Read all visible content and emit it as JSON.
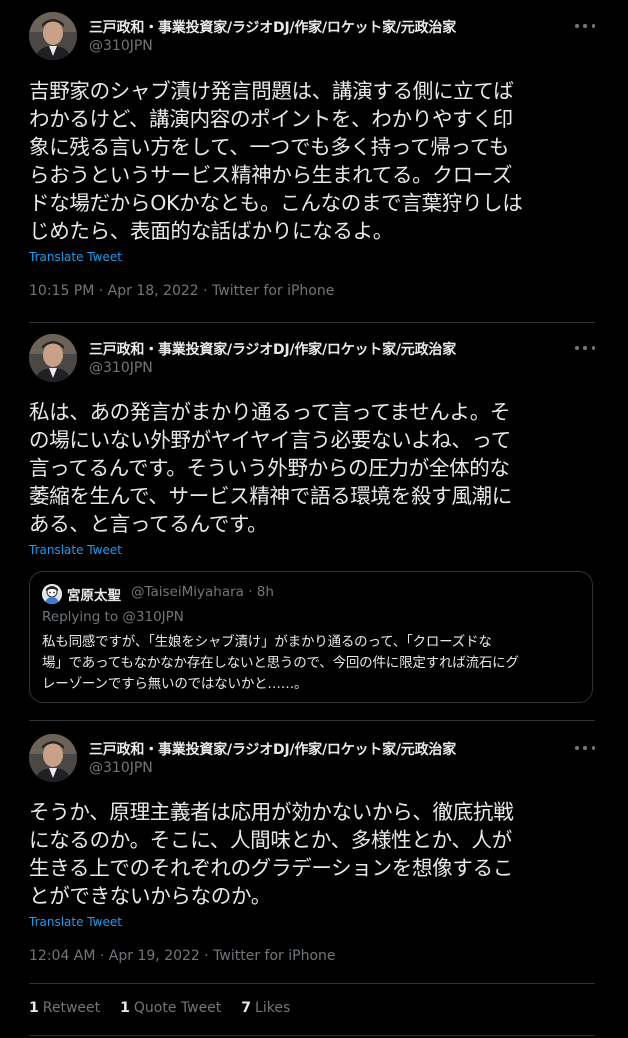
{
  "colors": {
    "background": "#000000",
    "text": "#e7e9ea",
    "secondary": "#71767b",
    "link": "#1d9bf0",
    "border": "#2f3336"
  },
  "tweets": [
    {
      "author_name": "三戸政和・事業投資家/ラジオDJ/作家/ロケット家/元政治家",
      "author_handle": "@310JPN",
      "text": "吉野家のシャブ漬け発言問題は、講演する側に立てば\nわかるけど、講演内容のポイントを、わかりやすく印\n象に残る言い方をして、一つでも多く持って帰っても\nらおうというサービス精神から生まれてる。クローズ\nドな場だからOKかなとも。こんなのまで言葉狩りしは\nじめたら、表面的な話ばかりになるよ。",
      "translate_label": "Translate Tweet",
      "timestamp": "10:15 PM · Apr 18, 2022 · Twitter for iPhone"
    },
    {
      "author_name": "三戸政和・事業投資家/ラジオDJ/作家/ロケット家/元政治家",
      "author_handle": "@310JPN",
      "text": "私は、あの発言がまかり通るって言ってませんよ。そ\nの場にいない外野がヤイヤイ言う必要ないよね、って\n言ってるんです。そういう外野からの圧力が全体的な\n萎縮を生んで、サービス精神で語る環境を殺す風潮に\nある、と言ってるんです。",
      "translate_label": "Translate Tweet",
      "quoted": {
        "author_name": "宮原太聖",
        "author_handle_time": "@TaiseiMiyahara · 8h",
        "replying_to": "Replying to @310JPN",
        "text": "私も同感ですが、「生娘をシャブ漬け」がまかり通るのって、「クローズドな\n場」であってもなかなか存在しないと思うので、今回の件に限定すれば流石にグ\nレーゾーンですら無いのではないかと……。"
      }
    },
    {
      "author_name": "三戸政和・事業投資家/ラジオDJ/作家/ロケット家/元政治家",
      "author_handle": "@310JPN",
      "text": "そうか、原理主義者は応用が効かないから、徹底抗戦\nになるのか。そこに、人間味とか、多様性とか、人が\n生きる上でのそれぞれのグラデーションを想像するこ\nとができないからなのか。",
      "translate_label": "Translate Tweet",
      "timestamp": "12:04 AM · Apr 19, 2022 · Twitter for iPhone"
    }
  ],
  "stats": {
    "retweets_count": "1",
    "retweets_label": "Retweet",
    "quotes_count": "1",
    "quotes_label": "Quote Tweet",
    "likes_count": "7",
    "likes_label": "Likes"
  },
  "icons": {
    "more": "more-horizontal-icon",
    "avatar": "profile-avatar",
    "quote_avatar": "quote-author-avatar"
  }
}
